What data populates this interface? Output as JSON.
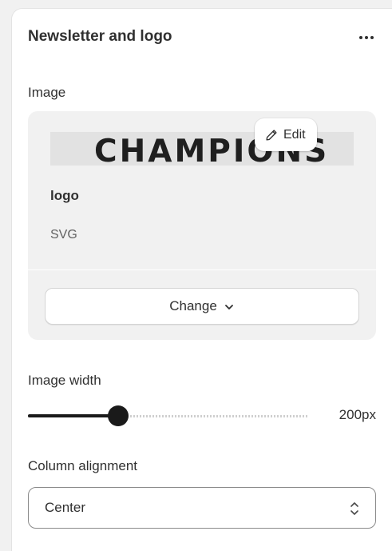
{
  "section": {
    "title": "Newsletter and logo",
    "more_icon": "horizontal-dots-icon"
  },
  "image": {
    "label": "Image",
    "logo_text": "CHAMPIONS",
    "edit_label": "Edit",
    "edit_icon": "pencil-icon",
    "file_name": "logo",
    "file_type": "SVG",
    "change_label": "Change",
    "change_icon": "chevron-down-icon"
  },
  "image_width": {
    "label": "Image width",
    "value_text": "200px",
    "slider_fraction": 0.32
  },
  "column_alignment": {
    "label": "Column alignment",
    "selected": "Center",
    "select_icon": "up-down-chevron-icon"
  },
  "colors": {
    "panel_bg": "#ffffff",
    "page_bg": "#f1f1f1",
    "card_bg": "#f1f1f1",
    "text": "#303030",
    "slider_fill": "#1a1a1a"
  }
}
